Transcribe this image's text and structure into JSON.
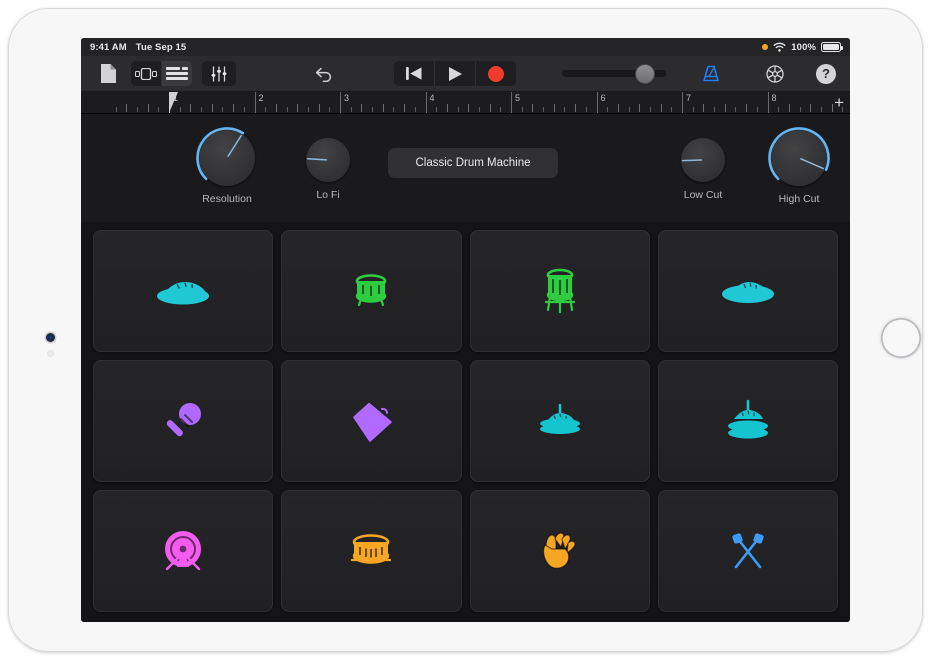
{
  "device": {
    "type": "ipad-landscape",
    "camera_icon": "camera-lens",
    "home_icon": "home-button"
  },
  "status_bar": {
    "time": "9:41 AM",
    "date": "Tue Sep 15",
    "recording_indicator_color": "#f5a623",
    "wifi_icon": "wifi-icon",
    "battery_percent": "100%",
    "battery_icon": "battery-full-icon"
  },
  "toolbar": {
    "items": [
      {
        "name": "documents-button",
        "icon": "document-icon",
        "label": ""
      },
      {
        "name": "view-browser-button",
        "icon": "cells-view-icon",
        "label": "",
        "selected": false
      },
      {
        "name": "view-tracks-button",
        "icon": "tracks-view-icon",
        "label": "",
        "selected": true
      },
      {
        "name": "mixer-button",
        "icon": "faders-icon",
        "label": ""
      },
      {
        "name": "undo-button",
        "icon": "undo-arrow-icon",
        "label": ""
      },
      {
        "name": "rewind-button",
        "icon": "rewind-icon",
        "label": ""
      },
      {
        "name": "play-button",
        "icon": "play-icon",
        "label": ""
      },
      {
        "name": "record-button",
        "icon": "record-circle-icon",
        "label": ""
      },
      {
        "name": "master-volume-slider",
        "icon": "slider-knob",
        "value_percent": 74
      },
      {
        "name": "metronome-button",
        "icon": "metronome-icon",
        "label": "",
        "active": true
      },
      {
        "name": "settings-button",
        "icon": "gear-icon",
        "label": ""
      },
      {
        "name": "help-button",
        "icon": "question-mark-icon",
        "label": "?"
      }
    ],
    "record_color": "#f03c2e",
    "metronome_color": "#1e80ff"
  },
  "ruler": {
    "bars": [
      "1",
      "2",
      "3",
      "4",
      "5",
      "6",
      "7",
      "8"
    ],
    "playhead_bar": "1",
    "add_button_label": "+",
    "add_button_icon": "plus-icon"
  },
  "plugin": {
    "patch_name": "Classic Drum Machine",
    "knobs": [
      {
        "name": "resolution-knob",
        "label": "Resolution",
        "size": "large",
        "arc": true,
        "value_percent": 62
      },
      {
        "name": "lo-fi-knob",
        "label": "Lo Fi",
        "size": "small",
        "arc": false,
        "value_percent": 18
      },
      {
        "name": "low-cut-knob",
        "label": "Low Cut",
        "size": "small",
        "arc": false,
        "value_percent": 16
      },
      {
        "name": "high-cut-knob",
        "label": "High Cut",
        "size": "large",
        "arc": true,
        "value_percent": 92
      }
    ],
    "knob_arc_color": "#64b5f6",
    "knob_pointer_color": "#8fb8d8"
  },
  "pads": [
    {
      "name": "pad-closed-hi-hat",
      "icon": "cymbal-closed-icon",
      "label": "",
      "color": "#1fc8d4"
    },
    {
      "name": "pad-tom-high",
      "icon": "tom-drum-icon",
      "label": "",
      "color": "#2ecc40"
    },
    {
      "name": "pad-floor-tom",
      "icon": "floor-tom-icon",
      "label": "",
      "color": "#2ecc40"
    },
    {
      "name": "pad-cymbal-flat",
      "icon": "cymbal-flat-icon",
      "label": "",
      "color": "#1fc8d4"
    },
    {
      "name": "pad-maraca",
      "icon": "maraca-icon",
      "label": "",
      "color": "#b06aff"
    },
    {
      "name": "pad-cowbell",
      "icon": "cowbell-icon",
      "label": "",
      "color": "#b06aff"
    },
    {
      "name": "pad-hi-hat-closed",
      "icon": "hi-hat-closed-icon",
      "label": "",
      "color": "#14c4cf"
    },
    {
      "name": "pad-hi-hat-open",
      "icon": "hi-hat-open-icon",
      "label": "",
      "color": "#14c4cf"
    },
    {
      "name": "pad-kick-drum",
      "icon": "kick-drum-icon",
      "label": "",
      "color": "#f45cf0"
    },
    {
      "name": "pad-snare-drum",
      "icon": "snare-drum-icon",
      "label": "",
      "color": "#f5a623"
    },
    {
      "name": "pad-hand-clap",
      "icon": "hand-clap-icon",
      "label": "",
      "color": "#f5a623"
    },
    {
      "name": "pad-drumsticks",
      "icon": "drumsticks-icon",
      "label": "",
      "color": "#3d9bf5"
    }
  ]
}
